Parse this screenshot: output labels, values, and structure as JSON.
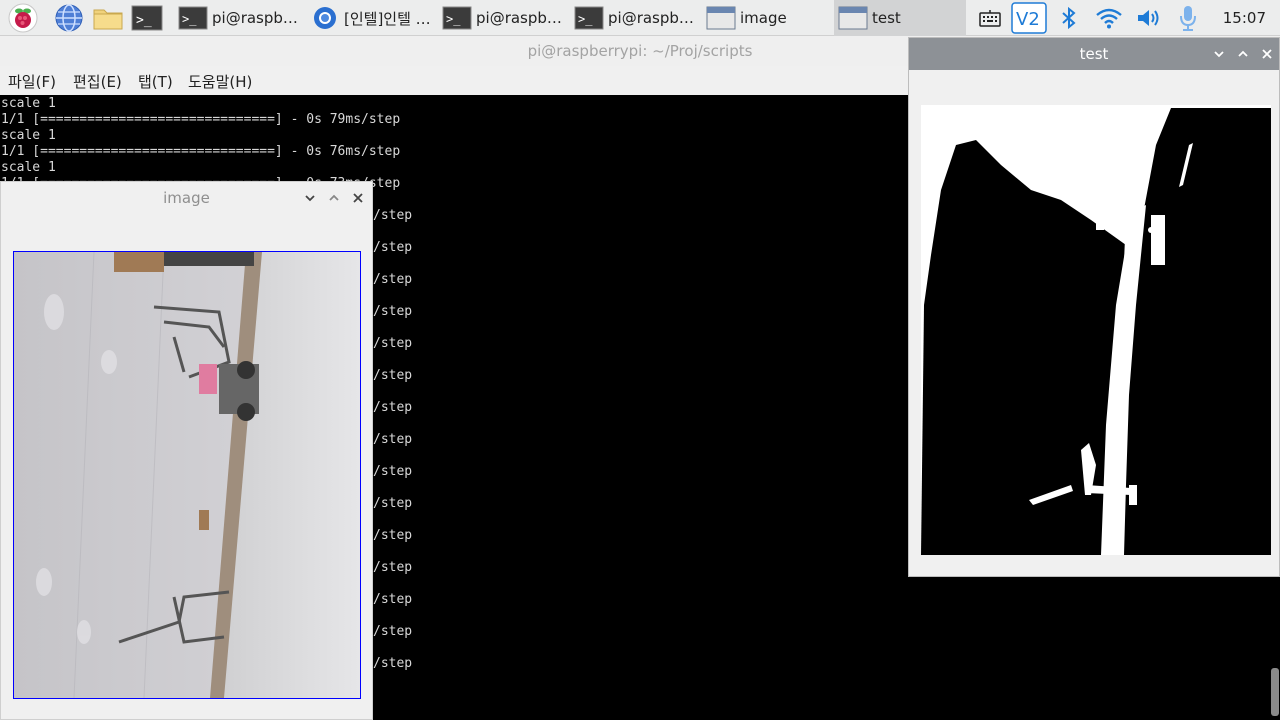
{
  "taskbar": {
    "tasks": [
      {
        "label": "pi@raspber…"
      },
      {
        "label": "[인텔]인텔 …"
      },
      {
        "label": "pi@raspber…"
      },
      {
        "label": "pi@raspber…"
      },
      {
        "label": "image"
      },
      {
        "label": "test"
      }
    ],
    "clock": "15:07"
  },
  "terminal": {
    "title": "pi@raspberrypi: ~/Proj/scripts",
    "menu": [
      "파일(F)",
      "편집(E)",
      "탭(T)",
      "도움말(H)"
    ],
    "lines": [
      "scale 1",
      "1/1 [==============================] - 0s 79ms/step",
      "scale 1",
      "1/1 [==============================] - 0s 76ms/step",
      "scale 1",
      "1/1 [==============================] - 0s 73ms/step"
    ],
    "hidden_line_suffix": "/step"
  },
  "image_window": {
    "title": "image"
  },
  "test_window": {
    "title": "test"
  },
  "colors": {
    "taskbar_bg": "#eceded",
    "terminal_bg": "#000000",
    "terminal_fg": "#d8d8d8",
    "image_border": "#0000ff",
    "test_titlebar": "#8d9196"
  }
}
